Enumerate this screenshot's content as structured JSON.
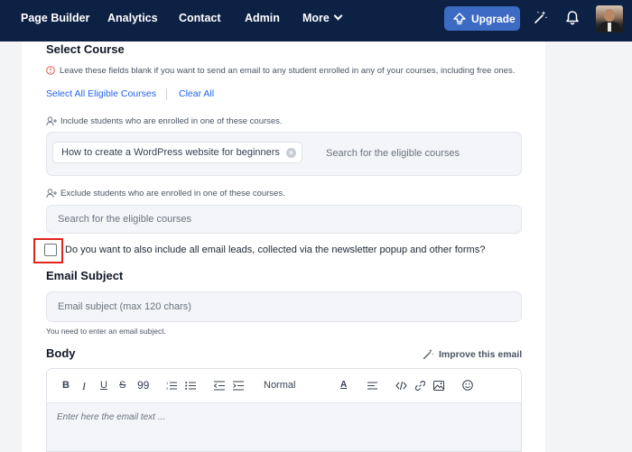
{
  "nav": {
    "items": [
      "Page Builder",
      "Analytics",
      "Contact",
      "Admin"
    ],
    "more_label": "More",
    "upgrade_label": "Upgrade"
  },
  "course": {
    "title": "Select Course",
    "info": "Leave these fields blank if you want to send an email to any student enrolled in any of your courses, including free ones.",
    "select_all": "Select All Eligible Courses",
    "clear_all": "Clear All",
    "include_label": "Include students who are enrolled in one of these courses.",
    "include_chip": "How to create a WordPress website for beginners",
    "include_placeholder": "Search for the eligible courses",
    "exclude_label": "Exclude students who are enrolled in one of these courses.",
    "exclude_placeholder": "Search for the eligible courses"
  },
  "leads": {
    "checked": false,
    "label": "Do you want to also include all email leads, collected via the newsletter popup and other forms?"
  },
  "subject": {
    "title": "Email Subject",
    "placeholder": "Email subject (max 120 chars)",
    "hint": "You need to enter an email subject."
  },
  "body": {
    "title": "Body",
    "improve_label": "Improve this email",
    "format_select": "Normal",
    "placeholder": "Enter here the email text ..."
  },
  "colors": {
    "navbar": "#0d2145",
    "upgrade": "#3d6bc4",
    "link": "#2563eb",
    "highlight": "#e0241d"
  }
}
